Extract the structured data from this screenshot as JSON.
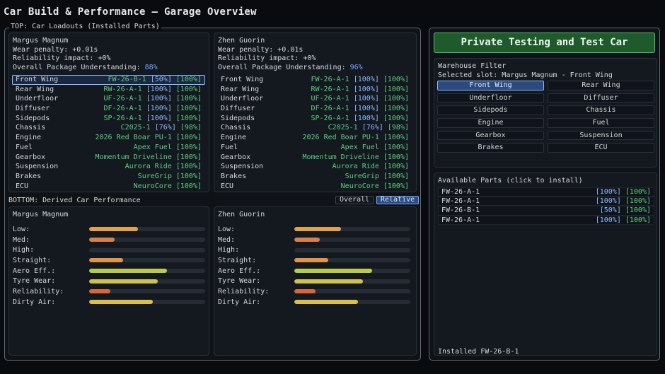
{
  "title": "Car Build & Performance — Garage Overview",
  "top_label": "TOP: Car Loadouts (Installed Parts)",
  "bottom_label": "BOTTOM: Derived Car Performance",
  "toggle": {
    "overall": "Overall",
    "relative": "Relative",
    "selected": "relative"
  },
  "loadouts": [
    {
      "driver": "Margus Magnum",
      "wear": "Wear penalty: +0.01s",
      "reliability": "Reliability impact: +0%",
      "understanding_label": "Overall Package Understanding: ",
      "understanding_value": "88%",
      "parts": [
        {
          "slot": "Front Wing",
          "name": "FW-26-B-1",
          "perf": "[50%]",
          "qual": "[100%]",
          "selected": true
        },
        {
          "slot": "Rear Wing",
          "name": "RW-26-A-1",
          "perf": "[100%]",
          "qual": "[100%]"
        },
        {
          "slot": "Underfloor",
          "name": "UF-26-A-1",
          "perf": "[100%]",
          "qual": "[100%]"
        },
        {
          "slot": "Diffuser",
          "name": "DF-26-A-1",
          "perf": "[100%]",
          "qual": "[100%]"
        },
        {
          "slot": "Sidepods",
          "name": "SP-26-A-1",
          "perf": "[100%]",
          "qual": "[100%]"
        },
        {
          "slot": "Chassis",
          "name": "C2025-1",
          "perf": "[76%]",
          "qual": "[98%]"
        },
        {
          "slot": "Engine",
          "name": "2026 Red Boar PU-1",
          "perf": "",
          "qual": "[100%]"
        },
        {
          "slot": "Fuel",
          "name": "Apex Fuel",
          "perf": "",
          "qual": "[100%]"
        },
        {
          "slot": "Gearbox",
          "name": "Momentum Driveline",
          "perf": "",
          "qual": "[100%]"
        },
        {
          "slot": "Suspension",
          "name": "Aurora Ride",
          "perf": "",
          "qual": "[100%]"
        },
        {
          "slot": "Brakes",
          "name": "SureGrip",
          "perf": "",
          "qual": "[100%]"
        },
        {
          "slot": "ECU",
          "name": "NeuroCore",
          "perf": "",
          "qual": "[100%]"
        }
      ]
    },
    {
      "driver": "Zhen Guorin",
      "wear": "Wear penalty: +0.01s",
      "reliability": "Reliability impact: +0%",
      "understanding_label": "Overall Package Understanding: ",
      "understanding_value": "96%",
      "parts": [
        {
          "slot": "Front Wing",
          "name": "FW-26-A-1",
          "perf": "[100%]",
          "qual": "[100%]"
        },
        {
          "slot": "Rear Wing",
          "name": "RW-26-A-1",
          "perf": "[100%]",
          "qual": "[100%]"
        },
        {
          "slot": "Underfloor",
          "name": "UF-26-A-1",
          "perf": "[100%]",
          "qual": "[100%]"
        },
        {
          "slot": "Diffuser",
          "name": "DF-26-A-1",
          "perf": "[100%]",
          "qual": "[100%]"
        },
        {
          "slot": "Sidepods",
          "name": "SP-26-A-1",
          "perf": "[100%]",
          "qual": "[100%]"
        },
        {
          "slot": "Chassis",
          "name": "C2025-1",
          "perf": "[76%]",
          "qual": "[98%]"
        },
        {
          "slot": "Engine",
          "name": "2026 Red Boar PU-1",
          "perf": "",
          "qual": "[100%]"
        },
        {
          "slot": "Fuel",
          "name": "Apex Fuel",
          "perf": "",
          "qual": "[100%]"
        },
        {
          "slot": "Gearbox",
          "name": "Momentum Driveline",
          "perf": "",
          "qual": "[100%]"
        },
        {
          "slot": "Suspension",
          "name": "Aurora Ride",
          "perf": "",
          "qual": "[100%]"
        },
        {
          "slot": "Brakes",
          "name": "SureGrip",
          "perf": "",
          "qual": "[100%]"
        },
        {
          "slot": "ECU",
          "name": "NeuroCore",
          "perf": "",
          "qual": "[100%]"
        }
      ]
    }
  ],
  "performance": [
    {
      "driver": "Margus Magnum",
      "metrics": [
        {
          "label": "Low:",
          "value": 0.42,
          "color": "#e0a24a"
        },
        {
          "label": "Med:",
          "value": 0.22,
          "color": "#d9804a"
        },
        {
          "label": "High:",
          "value": 0.0,
          "color": "#d9804a"
        },
        {
          "label": "Straight:",
          "value": 0.29,
          "color": "#e0954a"
        },
        {
          "label": "Aero Eff.:",
          "value": 0.67,
          "color": "#b8cc4a"
        },
        {
          "label": "Tyre Wear:",
          "value": 0.59,
          "color": "#cfc44a"
        },
        {
          "label": "Reliability:",
          "value": 0.18,
          "color": "#d46a3c"
        },
        {
          "label": "Dirty Air:",
          "value": 0.55,
          "color": "#d8c04a"
        }
      ]
    },
    {
      "driver": "Zhen Guorin",
      "metrics": [
        {
          "label": "Low:",
          "value": 0.4,
          "color": "#e0a24a"
        },
        {
          "label": "Med:",
          "value": 0.22,
          "color": "#d9804a"
        },
        {
          "label": "High:",
          "value": 0.0,
          "color": "#d9804a"
        },
        {
          "label": "Straight:",
          "value": 0.29,
          "color": "#e0954a"
        },
        {
          "label": "Aero Eff.:",
          "value": 0.67,
          "color": "#b8cc4a"
        },
        {
          "label": "Tyre Wear:",
          "value": 0.59,
          "color": "#cfc44a"
        },
        {
          "label": "Reliability:",
          "value": 0.18,
          "color": "#d46a3c"
        },
        {
          "label": "Dirty Air:",
          "value": 0.55,
          "color": "#d8c04a"
        }
      ]
    }
  ],
  "private_testing_button": "Private Testing and Test Car",
  "warehouse": {
    "title": "Warehouse Filter",
    "selected_slot": "Selected slot: Margus Magnum - Front Wing",
    "slots": [
      {
        "label": "Front Wing",
        "selected": true
      },
      {
        "label": "Rear Wing"
      },
      {
        "label": "Underfloor"
      },
      {
        "label": "Diffuser"
      },
      {
        "label": "Sidepods"
      },
      {
        "label": "Chassis"
      },
      {
        "label": "Engine"
      },
      {
        "label": "Fuel"
      },
      {
        "label": "Gearbox"
      },
      {
        "label": "Suspension"
      },
      {
        "label": "Brakes"
      },
      {
        "label": "ECU"
      }
    ]
  },
  "available_parts": {
    "title": "Available Parts (click to install)",
    "items": [
      {
        "name": "FW-26-A-1",
        "perf": "[100%]",
        "qual": "[100%]"
      },
      {
        "name": "FW-26-A-1",
        "perf": "[100%]",
        "qual": "[100%]"
      },
      {
        "name": "FW-26-B-1",
        "perf": "[50%]",
        "qual": "[100%]"
      },
      {
        "name": "FW-26-A-1",
        "perf": "[100%]",
        "qual": "[100%]"
      }
    ]
  },
  "installed_status": "Installed FW-26-B-1",
  "colors": {
    "accent_blue": "#8fb8ff",
    "value_green": "#5fcf83",
    "primary_button": "#1f5a2c"
  }
}
